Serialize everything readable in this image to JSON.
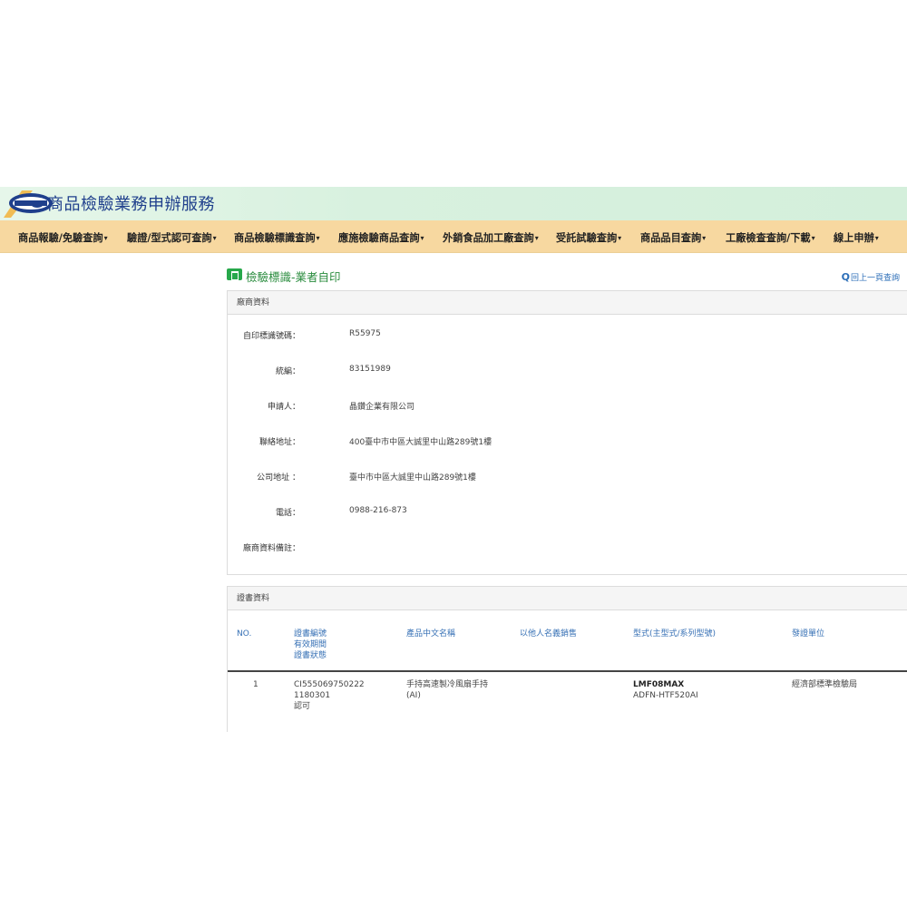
{
  "header": {
    "site_title": "商品檢驗業務申辦服務",
    "logo_icon": "bsmi-logo-icon"
  },
  "nav": {
    "items": [
      {
        "label": "商品報驗/免驗查詢"
      },
      {
        "label": "驗證/型式認可查詢"
      },
      {
        "label": "商品檢驗標識查詢"
      },
      {
        "label": "應施檢驗商品查詢"
      },
      {
        "label": "外銷食品加工廠查詢"
      },
      {
        "label": "受託試驗查詢"
      },
      {
        "label": "商品品目查詢"
      },
      {
        "label": "工廠檢查查詢/下載"
      },
      {
        "label": "線上申辦"
      }
    ]
  },
  "page": {
    "title": "檢驗標識-業者自印",
    "back_link": "回上一頁查詢",
    "doc_icon": "document-icon",
    "search_icon": "magnifier-icon"
  },
  "company": {
    "heading": "廠商資料",
    "fields": [
      {
        "label": "自印標識號碼：",
        "value": "R55975"
      },
      {
        "label": "統編：",
        "value": "83151989"
      },
      {
        "label": "申請人：",
        "value": "晶鑽企業有限公司"
      },
      {
        "label": "聯絡地址：",
        "value": "400臺中市中區大誠里中山路289號1樓"
      },
      {
        "label": "公司地址 ：",
        "value": "臺中市中區大誠里中山路289號1樓"
      },
      {
        "label": "電話：",
        "value": "0988-216-873"
      },
      {
        "label": "廠商資料備註：",
        "value": ""
      }
    ]
  },
  "certificate": {
    "heading": "證書資料",
    "columns": {
      "no": "NO.",
      "cert_lines": [
        "證書編號",
        "有效期間",
        "證書狀態"
      ],
      "product_name": "產品中文名稱",
      "sold_under": "以他人名義銷售",
      "model": "型式(主型式/系列型號)",
      "issuer": "發證單位"
    },
    "rows": [
      {
        "no": "1",
        "cert_number": "CI555069750222",
        "valid_period": "1180301",
        "status": "認可",
        "product_name_lines": [
          "手持高速製冷風扇手持",
          "(AI)"
        ],
        "sold_under": "",
        "model_main": "LMF08MAX",
        "model_series": "ADFN-HTF520AI",
        "issuer": "經濟部標準檢驗局"
      }
    ]
  }
}
